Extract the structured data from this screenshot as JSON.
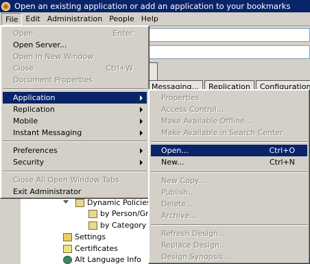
{
  "window": {
    "title": "Open an existing application or add an application to your bookmarks"
  },
  "menubar": [
    "File",
    "Edit",
    "Administration",
    "People",
    "Help"
  ],
  "tabs": [
    "Messaging...",
    "Replication",
    "Configuration"
  ],
  "file_menu": {
    "items": [
      {
        "label": "Open",
        "shortcut": "Enter",
        "disabled": true
      },
      {
        "label": "Open Server...",
        "shortcut": "",
        "disabled": false
      },
      {
        "label": "Open in New Window",
        "shortcut": "",
        "disabled": true
      },
      {
        "label": "Close",
        "shortcut": "Ctrl+W",
        "disabled": true
      },
      {
        "label": "Document Properties",
        "shortcut": "",
        "disabled": true
      },
      {
        "label": "Application",
        "submenu": true,
        "highlighted": true
      },
      {
        "label": "Replication",
        "submenu": true
      },
      {
        "label": "Mobile",
        "submenu": true
      },
      {
        "label": "Instant Messaging",
        "submenu": true
      },
      {
        "label": "Preferences",
        "submenu": true
      },
      {
        "label": "Security",
        "submenu": true
      },
      {
        "label": "Close All Open Window Tabs",
        "disabled": true
      },
      {
        "label": "Exit Administrator",
        "disabled": false
      }
    ]
  },
  "application_submenu": {
    "items": [
      {
        "label": "Properties",
        "disabled": true
      },
      {
        "label": "Access Control...",
        "disabled": true
      },
      {
        "label": "Make Available Offline...",
        "disabled": true
      },
      {
        "label": "Make Available in Search Center",
        "disabled": true
      },
      {
        "label": "Open...",
        "shortcut": "Ctrl+O",
        "highlighted": true
      },
      {
        "label": "New...",
        "shortcut": "Ctrl+N"
      },
      {
        "label": "New Copy...",
        "disabled": true
      },
      {
        "label": "Publish...",
        "disabled": true
      },
      {
        "label": "Delete...",
        "disabled": true
      },
      {
        "label": "Archive...",
        "disabled": true
      },
      {
        "label": "Refresh Design...",
        "disabled": true
      },
      {
        "label": "Replace Design...",
        "disabled": true
      },
      {
        "label": "Design Synopsis...",
        "disabled": true
      }
    ]
  },
  "tree": {
    "dynamic_policies": "Dynamic Policies",
    "by_person": "by Person/Gro",
    "by_category": "by Category",
    "settings": "Settings",
    "certificates": "Certificates",
    "alt_language": "Alt Language Info"
  }
}
